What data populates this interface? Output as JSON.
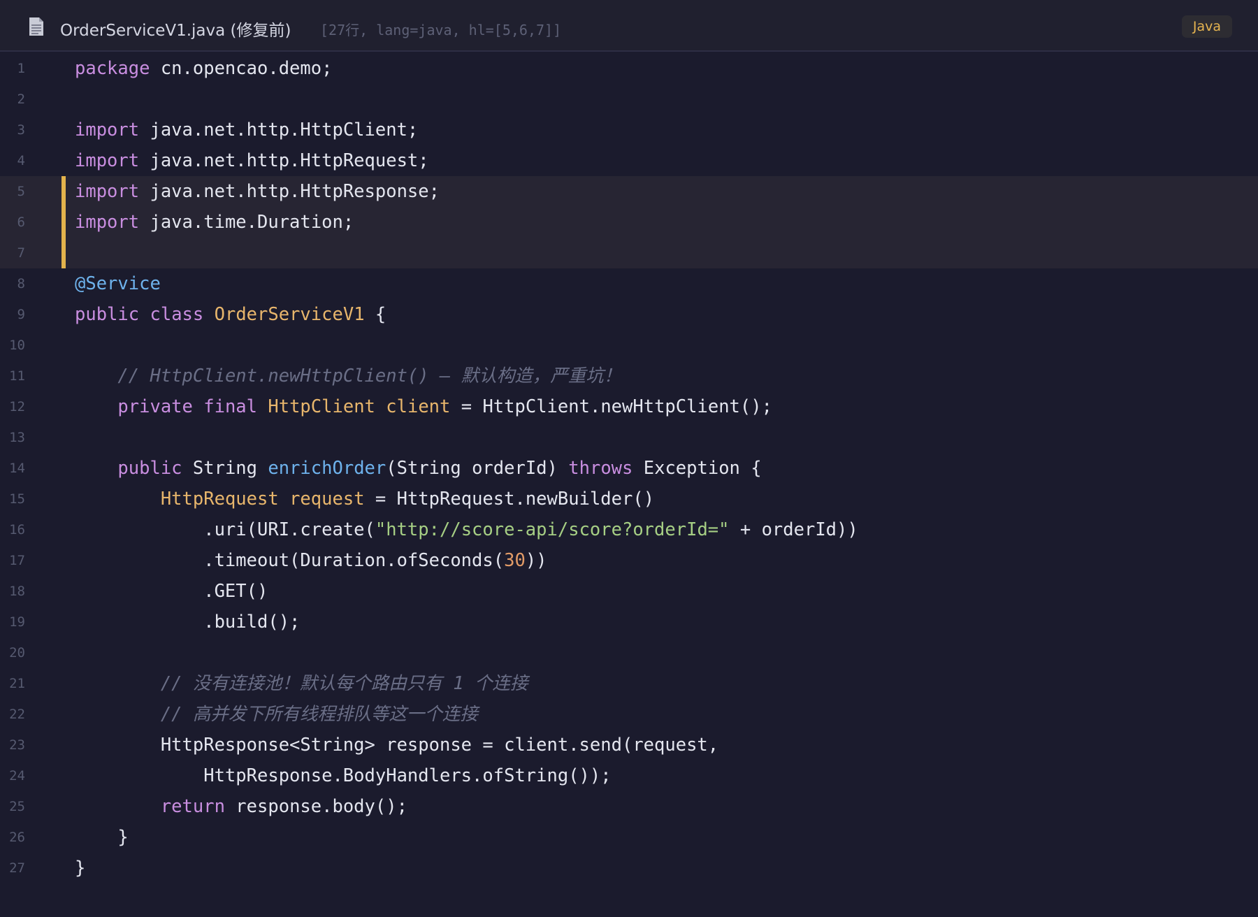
{
  "editor": {
    "file_name": "OrderServiceV1.java (修复前)",
    "meta": "[27行, lang=java, hl=[5,6,7]]",
    "language": "Java",
    "icons": {
      "file": "file-document-icon"
    },
    "colors": {
      "background": "#1b1b2d",
      "highlight_bar": "#e3b34c",
      "keyword": "#c98ee0",
      "type": "#e8b66c",
      "function": "#6eb2ec",
      "string": "#a6cf84",
      "number": "#e29b67",
      "comment": "#6a6e86"
    },
    "highlighted_lines": [
      5,
      6,
      7
    ],
    "lines": [
      {
        "n": "1",
        "tokens": [
          [
            "kw",
            "package"
          ],
          [
            "p",
            " cn.opencao.demo;"
          ]
        ]
      },
      {
        "n": "2",
        "tokens": []
      },
      {
        "n": "3",
        "tokens": [
          [
            "kw",
            "import"
          ],
          [
            "p",
            " java.net.http.HttpClient;"
          ]
        ]
      },
      {
        "n": "4",
        "tokens": [
          [
            "kw",
            "import"
          ],
          [
            "p",
            " java.net.http.HttpRequest;"
          ]
        ]
      },
      {
        "n": "5",
        "tokens": [
          [
            "kw",
            "import"
          ],
          [
            "p",
            " java.net.http.HttpResponse;"
          ]
        ]
      },
      {
        "n": "6",
        "tokens": [
          [
            "kw",
            "import"
          ],
          [
            "p",
            " java.time.Duration;"
          ]
        ]
      },
      {
        "n": "7",
        "tokens": []
      },
      {
        "n": "8",
        "tokens": [
          [
            "an",
            "@Service"
          ]
        ]
      },
      {
        "n": "9",
        "tokens": [
          [
            "kw",
            "public"
          ],
          [
            "p",
            " "
          ],
          [
            "kw",
            "class"
          ],
          [
            "p",
            " "
          ],
          [
            "ty",
            "OrderServiceV1"
          ],
          [
            "p",
            " {"
          ]
        ]
      },
      {
        "n": "10",
        "tokens": []
      },
      {
        "n": "11",
        "tokens": [
          [
            "p",
            "    "
          ],
          [
            "cm",
            "// HttpClient.newHttpClient() — 默认构造，严重坑！"
          ]
        ]
      },
      {
        "n": "12",
        "tokens": [
          [
            "p",
            "    "
          ],
          [
            "kw",
            "private"
          ],
          [
            "p",
            " "
          ],
          [
            "kw",
            "final"
          ],
          [
            "p",
            " "
          ],
          [
            "ty",
            "HttpClient"
          ],
          [
            "p",
            " "
          ],
          [
            "ty",
            "client"
          ],
          [
            "p",
            " = HttpClient.newHttpClient();"
          ]
        ]
      },
      {
        "n": "13",
        "tokens": []
      },
      {
        "n": "14",
        "tokens": [
          [
            "p",
            "    "
          ],
          [
            "kw",
            "public"
          ],
          [
            "p",
            " String "
          ],
          [
            "fn",
            "enrichOrder"
          ],
          [
            "p",
            "(String orderId) "
          ],
          [
            "kw",
            "throws"
          ],
          [
            "p",
            " Exception {"
          ]
        ]
      },
      {
        "n": "15",
        "tokens": [
          [
            "p",
            "        "
          ],
          [
            "ty",
            "HttpRequest"
          ],
          [
            "p",
            " "
          ],
          [
            "ty",
            "request"
          ],
          [
            "p",
            " = HttpRequest.newBuilder()"
          ]
        ]
      },
      {
        "n": "16",
        "tokens": [
          [
            "p",
            "            .uri(URI.create("
          ],
          [
            "st",
            "\"http://score-api/score?orderId=\""
          ],
          [
            "p",
            " + orderId))"
          ]
        ]
      },
      {
        "n": "17",
        "tokens": [
          [
            "p",
            "            .timeout(Duration.ofSeconds("
          ],
          [
            "nu",
            "30"
          ],
          [
            "p",
            "))"
          ]
        ]
      },
      {
        "n": "18",
        "tokens": [
          [
            "p",
            "            .GET()"
          ]
        ]
      },
      {
        "n": "19",
        "tokens": [
          [
            "p",
            "            .build();"
          ]
        ]
      },
      {
        "n": "20",
        "tokens": []
      },
      {
        "n": "21",
        "tokens": [
          [
            "p",
            "        "
          ],
          [
            "cm",
            "// 没有连接池！默认每个路由只有 1 个连接"
          ]
        ]
      },
      {
        "n": "22",
        "tokens": [
          [
            "p",
            "        "
          ],
          [
            "cm",
            "// 高并发下所有线程排队等这一个连接"
          ]
        ]
      },
      {
        "n": "23",
        "tokens": [
          [
            "p",
            "        HttpResponse<String> response = client.send(request,"
          ]
        ]
      },
      {
        "n": "24",
        "tokens": [
          [
            "p",
            "            HttpResponse.BodyHandlers.ofString());"
          ]
        ]
      },
      {
        "n": "25",
        "tokens": [
          [
            "p",
            "        "
          ],
          [
            "kw",
            "return"
          ],
          [
            "p",
            " response.body();"
          ]
        ]
      },
      {
        "n": "26",
        "tokens": [
          [
            "p",
            "    }"
          ]
        ]
      },
      {
        "n": "27",
        "tokens": [
          [
            "p",
            "}"
          ]
        ]
      }
    ]
  }
}
